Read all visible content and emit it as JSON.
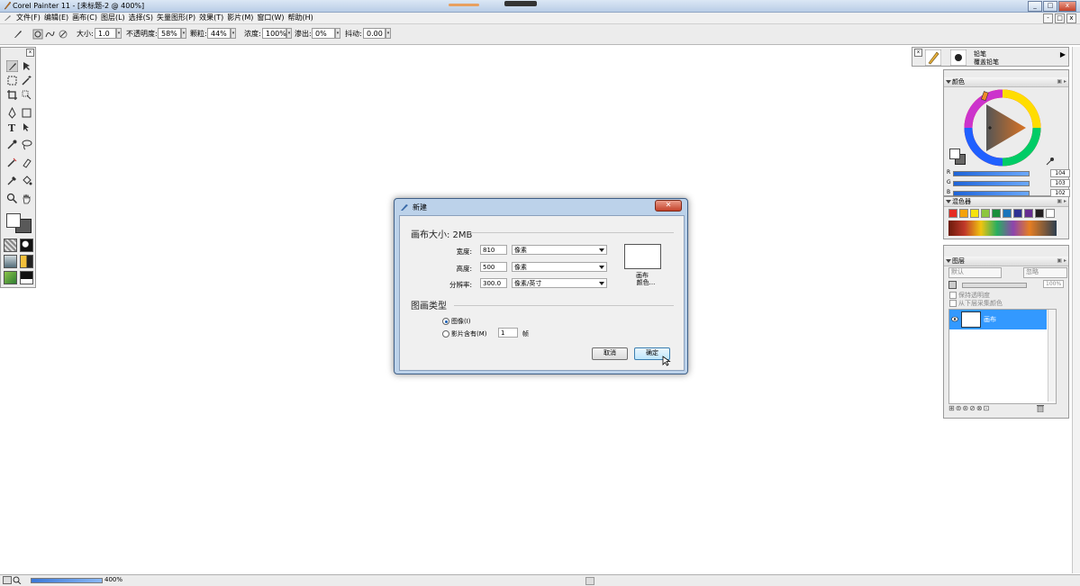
{
  "window": {
    "title": "Corel Painter 11 - [未标题-2 @ 400%]",
    "min_label": "_",
    "max_label": "□",
    "close_label": "x"
  },
  "menu": {
    "items": [
      "文件(F)",
      "编辑(E)",
      "画布(C)",
      "图层(L)",
      "选择(S)",
      "矢量图形(P)",
      "效果(T)",
      "影片(M)",
      "窗口(W)",
      "帮助(H)"
    ]
  },
  "property_bar": {
    "size_label": "大小:",
    "size_value": "1.0",
    "opacity_label": "不透明度:",
    "opacity_value": "58%",
    "grain_label": "颗粒:",
    "grain_value": "44%",
    "resat_label": "浓度:",
    "resat_value": "100%",
    "bleed_label": "渗出:",
    "bleed_value": "0%",
    "jitter_label": "抖动:",
    "jitter_value": "0.00"
  },
  "dialog": {
    "title": "新建",
    "canvas_size_label": "画布大小: 2MB",
    "width_label": "宽度:",
    "width_value": "810",
    "width_unit": "像素",
    "height_label": "高度:",
    "height_value": "500",
    "height_unit": "像素",
    "resolution_label": "分辨率:",
    "resolution_value": "300.0",
    "resolution_unit": "像素/英寸",
    "paper_label_1": "画布",
    "paper_label_2": "颜色...",
    "picture_type_label": "图画类型",
    "option_image": "图像(I)",
    "option_movie": "影片含有(M)",
    "frames_value": "1",
    "frames_label": "帧",
    "cancel_label": "取消",
    "ok_label": "确定"
  },
  "brush_selector": {
    "category": "铅笔",
    "variant": "覆盖铅笔"
  },
  "colors_panel": {
    "title": "颜色",
    "r_label": "R",
    "r_value": "104",
    "g_label": "G",
    "g_value": "103",
    "b_label": "B",
    "b_value": "102",
    "current_color": "#686766"
  },
  "mixer_panel": {
    "title": "混色器",
    "swatches": [
      "#e52b22",
      "#f5a20a",
      "#f6e30c",
      "#8cc63f",
      "#1a8f3c",
      "#1b75bb",
      "#2e3192",
      "#662d91",
      "#231f20",
      "#ffffff"
    ]
  },
  "layers_panel": {
    "title": "图层",
    "composite_method": "默认",
    "composite_depth": "忽略",
    "opacity_value": "100%",
    "preserve_transparency": "保持透明度",
    "pick_up_underlying": "从下层采集颜色",
    "layer_name": "画布"
  },
  "status": {
    "zoom": "400%"
  }
}
